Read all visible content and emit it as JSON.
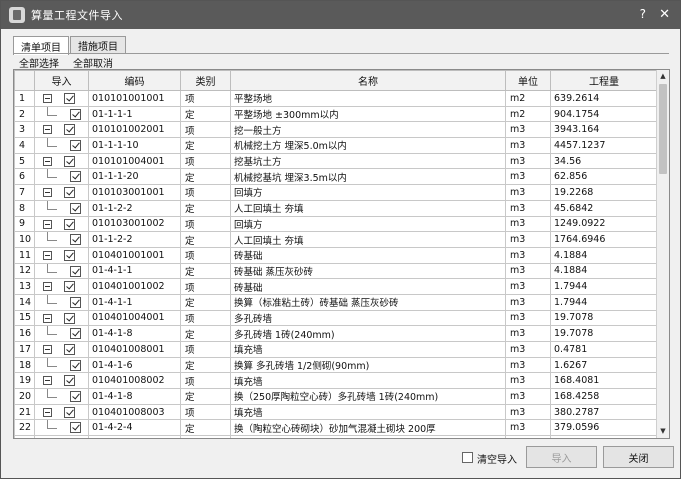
{
  "window": {
    "title": "算量工程文件导入",
    "help": "?",
    "close": "✕"
  },
  "tabs": [
    {
      "label": "清单项目"
    },
    {
      "label": "措施项目"
    }
  ],
  "actions": {
    "select_all": "全部选择",
    "deselect_all": "全部取消"
  },
  "table": {
    "headers": {
      "import": "导入",
      "code": "编码",
      "type": "类别",
      "name": "名称",
      "unit": "单位",
      "qty": "工程量"
    },
    "rows": [
      {
        "no": "1",
        "code": "010101001001",
        "type": "项",
        "name": "平整场地",
        "unit": "m2",
        "qty": "639.2614",
        "level": "parent"
      },
      {
        "no": "2",
        "code": "01-1-1-1",
        "type": "定",
        "name": "平整场地 ±300mm以内",
        "unit": "m2",
        "qty": "904.1754",
        "level": "child"
      },
      {
        "no": "3",
        "code": "010101002001",
        "type": "项",
        "name": "挖一般土方",
        "unit": "m3",
        "qty": "3943.164",
        "level": "parent"
      },
      {
        "no": "4",
        "code": "01-1-1-10",
        "type": "定",
        "name": "机械挖土方 埋深5.0m以内",
        "unit": "m3",
        "qty": "4457.1237",
        "level": "child"
      },
      {
        "no": "5",
        "code": "010101004001",
        "type": "项",
        "name": "挖基坑土方",
        "unit": "m3",
        "qty": "34.56",
        "level": "parent"
      },
      {
        "no": "6",
        "code": "01-1-1-20",
        "type": "定",
        "name": "机械挖基坑 埋深3.5m以内",
        "unit": "m3",
        "qty": "62.856",
        "level": "child"
      },
      {
        "no": "7",
        "code": "010103001001",
        "type": "项",
        "name": "回填方",
        "unit": "m3",
        "qty": "19.2268",
        "level": "parent"
      },
      {
        "no": "8",
        "code": "01-1-2-2",
        "type": "定",
        "name": "人工回填土 夯填",
        "unit": "m3",
        "qty": "45.6842",
        "level": "child"
      },
      {
        "no": "9",
        "code": "010103001002",
        "type": "项",
        "name": "回填方",
        "unit": "m3",
        "qty": "1249.0922",
        "level": "parent"
      },
      {
        "no": "10",
        "code": "01-1-2-2",
        "type": "定",
        "name": "人工回填土 夯填",
        "unit": "m3",
        "qty": "1764.6946",
        "level": "child"
      },
      {
        "no": "11",
        "code": "010401001001",
        "type": "项",
        "name": "砖基础",
        "unit": "m3",
        "qty": "4.1884",
        "level": "parent"
      },
      {
        "no": "12",
        "code": "01-4-1-1",
        "type": "定",
        "name": "砖基础 蒸压灰砂砖",
        "unit": "m3",
        "qty": "4.1884",
        "level": "child"
      },
      {
        "no": "13",
        "code": "010401001002",
        "type": "项",
        "name": "砖基础",
        "unit": "m3",
        "qty": "1.7944",
        "level": "parent"
      },
      {
        "no": "14",
        "code": "01-4-1-1",
        "type": "定",
        "name": "换算（标准粘土砖）砖基础 蒸压灰砂砖",
        "unit": "m3",
        "qty": "1.7944",
        "level": "child"
      },
      {
        "no": "15",
        "code": "010401004001",
        "type": "项",
        "name": "多孔砖墙",
        "unit": "m3",
        "qty": "19.7078",
        "level": "parent"
      },
      {
        "no": "16",
        "code": "01-4-1-8",
        "type": "定",
        "name": "多孔砖墙 1砖(240mm)",
        "unit": "m3",
        "qty": "19.7078",
        "level": "child"
      },
      {
        "no": "17",
        "code": "010401008001",
        "type": "项",
        "name": "填充墙",
        "unit": "m3",
        "qty": "0.4781",
        "level": "parent"
      },
      {
        "no": "18",
        "code": "01-4-1-6",
        "type": "定",
        "name": "换算  多孔砖墙 1/2侧砌(90mm)",
        "unit": "m3",
        "qty": "1.6267",
        "level": "child"
      },
      {
        "no": "19",
        "code": "010401008002",
        "type": "项",
        "name": "填充墙",
        "unit": "m3",
        "qty": "168.4081",
        "level": "parent"
      },
      {
        "no": "20",
        "code": "01-4-1-8",
        "type": "定",
        "name": "换（250厚陶粒空心砖）多孔砖墙 1砖(240mm)",
        "unit": "m3",
        "qty": "168.4258",
        "level": "child"
      },
      {
        "no": "21",
        "code": "010401008003",
        "type": "项",
        "name": "填充墙",
        "unit": "m3",
        "qty": "380.2787",
        "level": "parent"
      },
      {
        "no": "22",
        "code": "01-4-2-4",
        "type": "定",
        "name": "换（陶粒空心砖砌块）砂加气混凝土砌块 200厚",
        "unit": "m3",
        "qty": "379.0596",
        "level": "child"
      },
      {
        "no": "",
        "code": "",
        "type": "",
        "name": "",
        "unit": "",
        "qty": "",
        "level": "parent"
      }
    ]
  },
  "footer": {
    "clear_import": "清空导入",
    "import_btn": "导入",
    "close_btn": "关闭"
  },
  "icons": {
    "scroll_up": "▲",
    "scroll_down": "▼"
  }
}
